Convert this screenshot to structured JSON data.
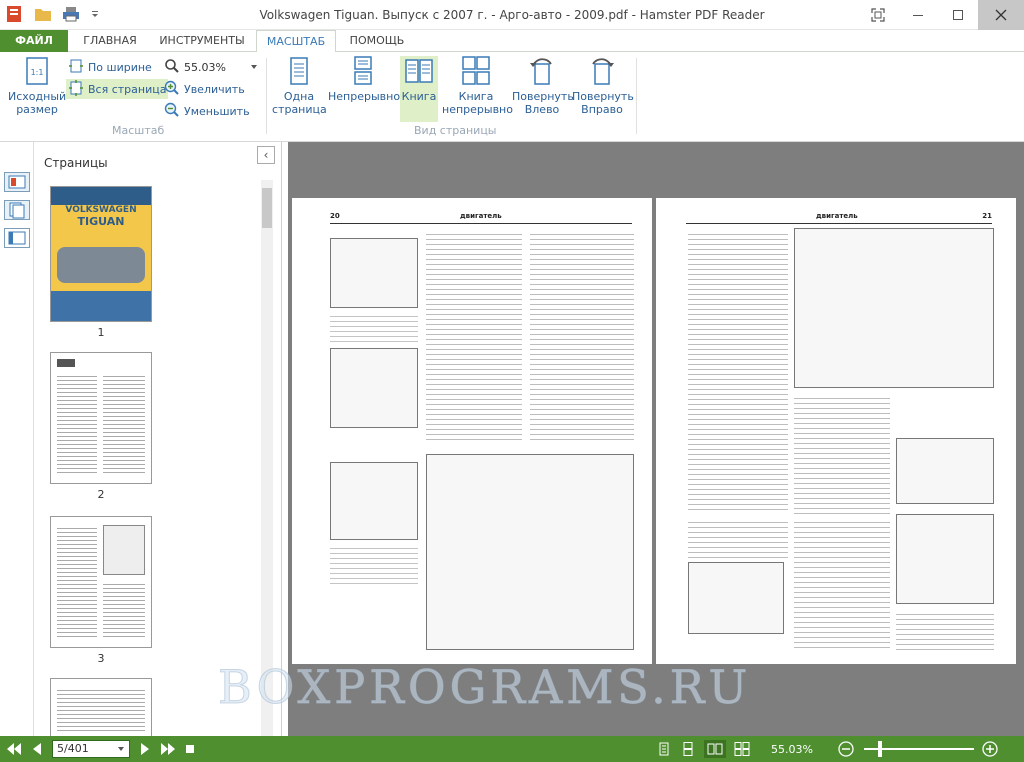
{
  "app": {
    "title": "Volkswagen Tiguan. Выпуск с 2007 г. - Арго-авто - 2009.pdf - Hamster PDF Reader"
  },
  "tabs": [
    {
      "label": "ФАЙЛ"
    },
    {
      "label": "ГЛАВНАЯ"
    },
    {
      "label": "ИНСТРУМЕНТЫ"
    },
    {
      "label": "МАСШТАБ"
    },
    {
      "label": "ПОМОЩЬ"
    }
  ],
  "ribbon": {
    "original_size_line1": "Исходный",
    "original_size_line2": "размер",
    "fit_width": "По ширине",
    "fit_page": "Вся страница",
    "zoom_value": "55.03%",
    "zoom_in": "Увеличить",
    "zoom_out": "Уменьшить",
    "group_scale": "Масштаб",
    "single_page_line1": "Одна",
    "single_page_line2": "страница",
    "continuous": "Непрерывно",
    "book": "Книга",
    "book_cont_line1": "Книга",
    "book_cont_line2": "непрерывно",
    "rotate_left_line1": "Повернуть",
    "rotate_left_line2": "Влево",
    "rotate_right_line1": "Повернуть",
    "rotate_right_line2": "Вправо",
    "group_view": "Вид страницы"
  },
  "sidebar": {
    "title": "Страницы",
    "thumbs": [
      {
        "label": "1",
        "cover_title": "VOLKSWAGEN",
        "cover_model": "TIGUAN"
      },
      {
        "label": "2"
      },
      {
        "label": "3"
      },
      {
        "label": ""
      }
    ]
  },
  "document": {
    "left_page_number": "20",
    "left_page_header": "двигатель",
    "right_page_number": "21",
    "right_page_header": "двигатель"
  },
  "watermark": "BOXPROGRAMS.RU",
  "status": {
    "page_field": "5/401",
    "zoom": "55.03%"
  },
  "colors": {
    "accent_green": "#4f8f2f",
    "ribbon_blue": "#2b5f95"
  }
}
